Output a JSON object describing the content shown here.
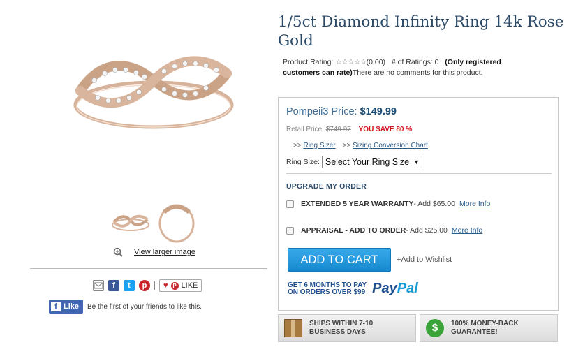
{
  "product": {
    "title": "1/5ct Diamond Infinity Ring 14k Rose Gold",
    "rating_label": "Product Rating:",
    "rating_stars": "☆☆☆☆☆",
    "rating_value": "(0.00)",
    "num_ratings_label": "# of Ratings: 0",
    "only_registered": "(Only registered customers can rate)",
    "no_comments": "There are no comments for this product."
  },
  "gallery": {
    "view_larger": "View larger image"
  },
  "share": {
    "like_label": "LIKE",
    "pin_letter": "P",
    "fb_like_label": "Like",
    "fb_text": "Be the first of your friends to like this."
  },
  "pricing": {
    "price_label": "Pompeii3 Price:",
    "price": "$149.99",
    "retail_label": "Retail Price:",
    "retail_price": "$749.97",
    "you_save": "YOU SAVE 80 %",
    "ring_sizer_prefix": ">>",
    "ring_sizer": "Ring Sizer",
    "sizing_chart_prefix": ">>",
    "sizing_chart": "Sizing Conversion Chart",
    "ring_size_label": "Ring Size:",
    "ring_size_selected": "Select Your Ring Size"
  },
  "upgrade": {
    "heading": "UPGRADE MY ORDER",
    "options": [
      {
        "name": "EXTENDED 5 YEAR WARRANTY",
        "price": " - Add $65.00",
        "more": "More Info"
      },
      {
        "name": "APPRAISAL - ADD TO ORDER",
        "price": " - Add $25.00",
        "more": "More Info"
      }
    ]
  },
  "cart": {
    "add_to_cart": "ADD TO CART",
    "wishlist": "+Add to Wishlist"
  },
  "paypal": {
    "line1": "GET 6 MONTHS TO PAY",
    "line2": "ON  ORDERS OVER $99",
    "logo_pay": "Pay",
    "logo_pal": "Pal"
  },
  "badges": {
    "shipping_line1": "SHIPS WITHIN 7-10",
    "shipping_line2": "BUSINESS DAYS",
    "money_line1": "100% MONEY-BACK",
    "money_line2": "GUARANTEE!"
  },
  "colors": {
    "title": "#2d4a67",
    "price": "#1d4d74",
    "save": "#d0121b",
    "cart_button": "#1689cf"
  }
}
